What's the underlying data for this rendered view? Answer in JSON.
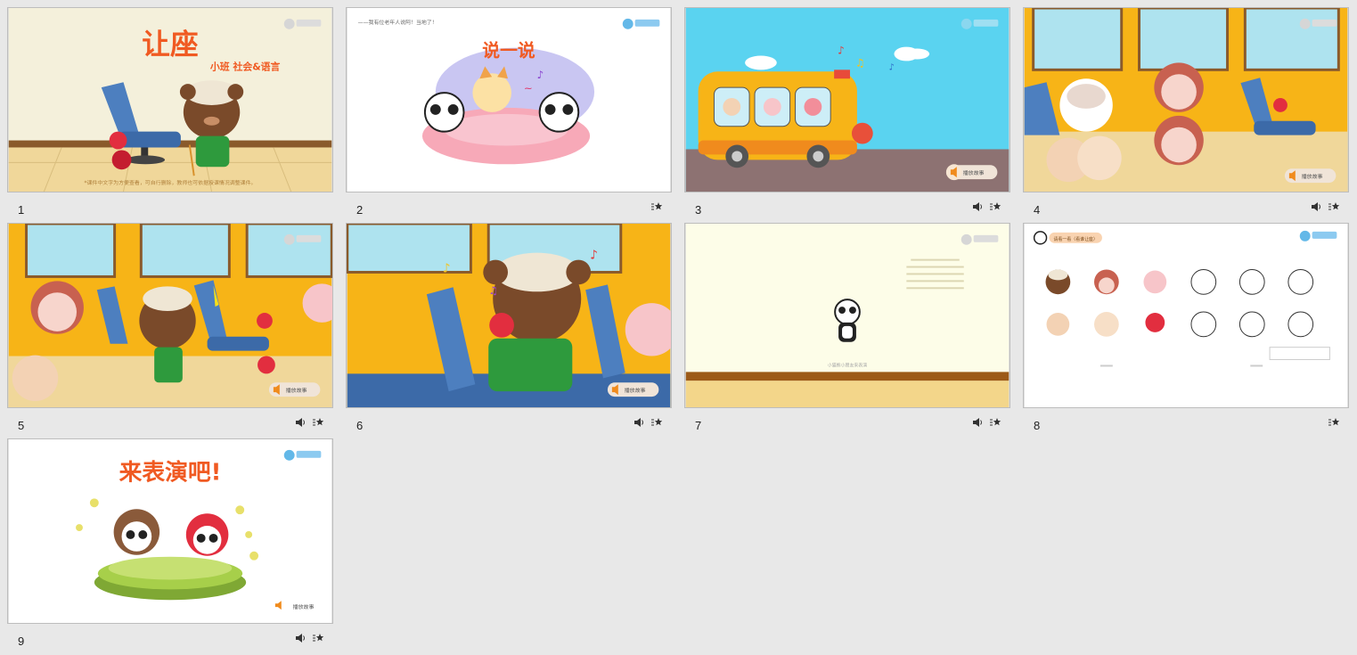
{
  "slides": [
    {
      "number": "1",
      "title": "让座",
      "subtitle": "小班  社会&语言",
      "footer": "*课件中文字为方便查看，可自行删除，教师也可依据授课情况调整课件。",
      "has_audio": false,
      "has_anim": false
    },
    {
      "number": "2",
      "header": "——我有位老年人说阿！当地了！",
      "title": "说一说",
      "has_audio": false,
      "has_anim": true
    },
    {
      "number": "3",
      "play_label": "播放故事",
      "has_audio": true,
      "has_anim": true
    },
    {
      "number": "4",
      "play_label": "播放故事",
      "has_audio": true,
      "has_anim": true
    },
    {
      "number": "5",
      "play_label": "播放故事",
      "has_audio": true,
      "has_anim": true
    },
    {
      "number": "6",
      "play_label": "播放故事",
      "has_audio": true,
      "has_anim": true
    },
    {
      "number": "7",
      "caption": "小猫熊小朋友来表演",
      "has_audio": true,
      "has_anim": true
    },
    {
      "number": "8",
      "header": "请看一看（看谁让座）",
      "has_audio": false,
      "has_anim": true
    },
    {
      "number": "9",
      "title": "来表演吧!",
      "play_label": "播放故事",
      "has_audio": true,
      "has_anim": true
    }
  ],
  "colors": {
    "accent_orange": "#f05a22",
    "bus_yellow": "#f7b417",
    "sky_blue": "#5ad3f0",
    "frame_border": "#bdbdbd"
  }
}
